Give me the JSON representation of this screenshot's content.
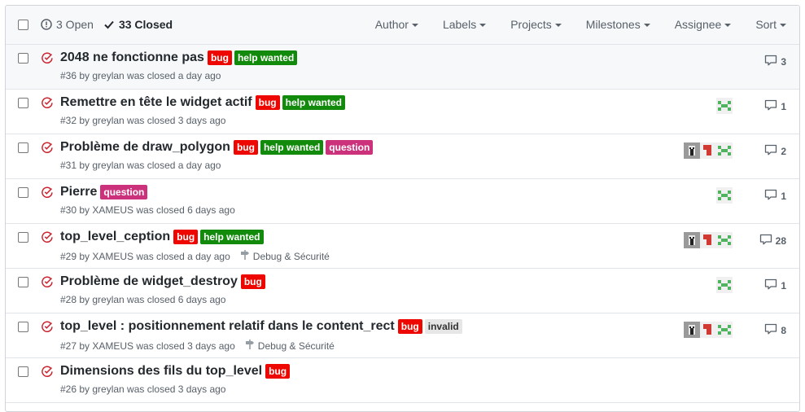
{
  "header": {
    "open_label": "3 Open",
    "closed_label": "33 Closed",
    "filters": [
      "Author",
      "Labels",
      "Projects",
      "Milestones",
      "Assignee",
      "Sort"
    ]
  },
  "label_colors": {
    "bug": {
      "bg": "#ee0701",
      "fg": "#ffffff"
    },
    "help wanted": {
      "bg": "#128a0c",
      "fg": "#ffffff"
    },
    "question": {
      "bg": "#cc317c",
      "fg": "#ffffff"
    },
    "invalid": {
      "bg": "#e6e6e6",
      "fg": "#333333"
    }
  },
  "issues": [
    {
      "title": "2048 ne fonctionne pas",
      "labels": [
        "bug",
        "help wanted"
      ],
      "meta": "#36 by greylan was closed a day ago",
      "milestone": "",
      "comments": "3",
      "assignees": []
    },
    {
      "title": "Remettre en tête le widget actif",
      "labels": [
        "bug",
        "help wanted"
      ],
      "meta": "#32 by greylan was closed 3 days ago",
      "milestone": "",
      "comments": "1",
      "assignees": [
        "green"
      ]
    },
    {
      "title": "Problème de draw_polygon",
      "labels": [
        "bug",
        "help wanted",
        "question"
      ],
      "meta": "#31 by greylan was closed a day ago",
      "milestone": "",
      "comments": "2",
      "assignees": [
        "gray",
        "red",
        "green"
      ]
    },
    {
      "title": "Pierre",
      "labels": [
        "question"
      ],
      "meta": "#30 by XAMEUS was closed 6 days ago",
      "milestone": "",
      "comments": "1",
      "assignees": [
        "green"
      ]
    },
    {
      "title": "top_level_ception",
      "labels": [
        "bug",
        "help wanted"
      ],
      "meta": "#29 by XAMEUS was closed a day ago",
      "milestone": "Debug & Sécurité",
      "comments": "28",
      "assignees": [
        "gray",
        "red",
        "green"
      ]
    },
    {
      "title": "Problème de widget_destroy",
      "labels": [
        "bug"
      ],
      "meta": "#28 by greylan was closed 6 days ago",
      "milestone": "",
      "comments": "1",
      "assignees": [
        "green"
      ]
    },
    {
      "title": "top_level : positionnement relatif dans le content_rect",
      "labels": [
        "bug",
        "invalid"
      ],
      "meta": "#27 by XAMEUS was closed 3 days ago",
      "milestone": "Debug & Sécurité",
      "comments": "8",
      "assignees": [
        "gray",
        "red",
        "green"
      ]
    },
    {
      "title": "Dimensions des fils du top_level",
      "labels": [
        "bug"
      ],
      "meta": "#26 by greylan was closed 3 days ago",
      "milestone": "",
      "comments": "",
      "assignees": []
    }
  ]
}
